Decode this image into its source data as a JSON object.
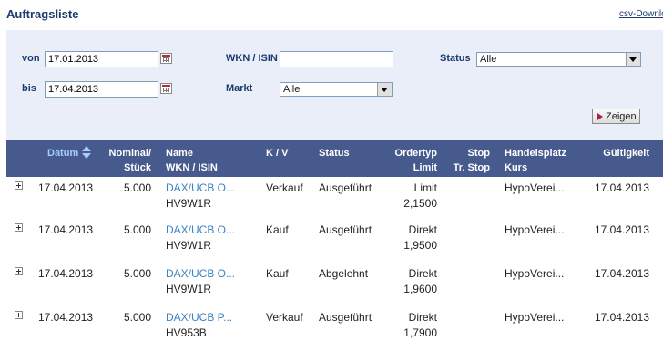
{
  "header": {
    "title": "Auftragsliste",
    "csv_link": "csv-Download"
  },
  "filter": {
    "von_label": "von",
    "von_value": "17.01.2013",
    "bis_label": "bis",
    "bis_value": "17.04.2013",
    "wkn_label": "WKN / ISIN",
    "wkn_value": "",
    "status_label": "Status",
    "status_value": "Alle",
    "markt_label": "Markt",
    "markt_value": "Alle",
    "show_button": "Zeigen"
  },
  "table": {
    "headers": {
      "datum": "Datum",
      "nominal1": "Nominal/",
      "nominal2": "Stück",
      "name1": "Name",
      "name2": "WKN / ISIN",
      "kv": "K / V",
      "status": "Status",
      "ordertyp1": "Ordertyp",
      "ordertyp2": "Limit",
      "stop1": "Stop",
      "stop2": "Tr. Stop",
      "handel1": "Handelsplatz",
      "handel2": "Kurs",
      "gueltig": "Gültigkeit"
    },
    "rows": [
      {
        "datum": "17.04.2013",
        "nominal": "5.000",
        "name": "DAX/UCB O...",
        "wkn": "HV9W1R",
        "kv": "Verkauf",
        "status": "Ausgeführt",
        "ordertyp": "Limit",
        "limit": "2,1500",
        "handelsplatz": "HypoVerei...",
        "gueltigkeit": "17.04.2013"
      },
      {
        "datum": "17.04.2013",
        "nominal": "5.000",
        "name": "DAX/UCB O...",
        "wkn": "HV9W1R",
        "kv": "Kauf",
        "status": "Ausgeführt",
        "ordertyp": "Direkt",
        "limit": "1,9500",
        "handelsplatz": "HypoVerei...",
        "gueltigkeit": "17.04.2013"
      },
      {
        "datum": "17.04.2013",
        "nominal": "5.000",
        "name": "DAX/UCB O...",
        "wkn": "HV9W1R",
        "kv": "Kauf",
        "status": "Abgelehnt",
        "ordertyp": "Direkt",
        "limit": "1,9600",
        "handelsplatz": "HypoVerei...",
        "gueltigkeit": "17.04.2013"
      },
      {
        "datum": "17.04.2013",
        "nominal": "5.000",
        "name": "DAX/UCB P...",
        "wkn": "HV953B",
        "kv": "Verkauf",
        "status": "Ausgeführt",
        "ordertyp": "Direkt",
        "limit": "1,7900",
        "handelsplatz": "HypoVerei...",
        "gueltigkeit": "17.04.2013"
      }
    ]
  },
  "colors": {
    "header_bg": "#475a8d",
    "filter_bg": "#e9eef9",
    "title": "#1c3c6e",
    "link": "#3a82c4",
    "sort_active": "#a6ccff"
  }
}
